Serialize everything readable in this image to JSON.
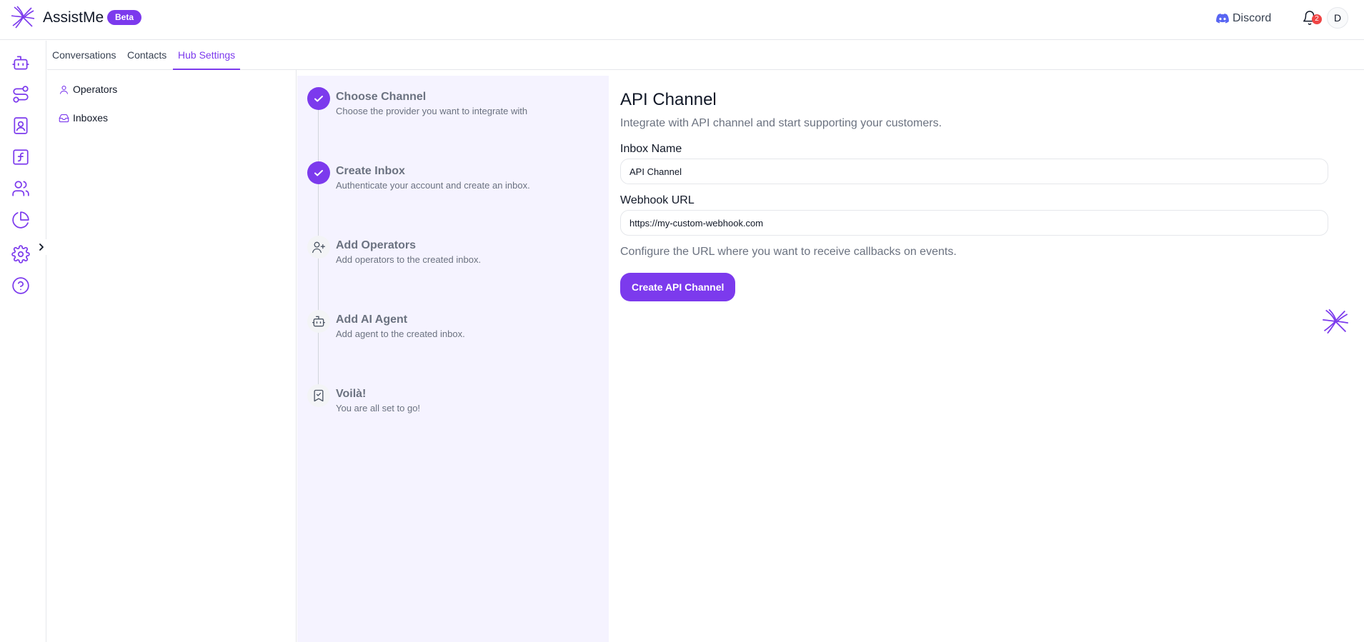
{
  "header": {
    "app_name": "AssistMe",
    "badge": "Beta",
    "discord_label": "Discord",
    "notification_count": "2",
    "avatar_initial": "D",
    "accent_color": "#7c3aed"
  },
  "rail": {
    "icons": [
      "bot-icon",
      "workflow-icon",
      "contact-book-icon",
      "function-icon",
      "users-icon",
      "pie-chart-icon",
      "gear-icon",
      "help-icon"
    ],
    "toggle_icon": "chevron-right-icon"
  },
  "tabs": [
    {
      "label": "Conversations",
      "active": false
    },
    {
      "label": "Contacts",
      "active": false
    },
    {
      "label": "Hub Settings",
      "active": true
    }
  ],
  "settings_sidebar": {
    "items": [
      {
        "label": "Operators",
        "icon": "user-icon"
      },
      {
        "label": "Inboxes",
        "icon": "inbox-icon"
      }
    ]
  },
  "stepper": {
    "steps": [
      {
        "title": "Choose Channel",
        "description": "Choose the provider you want to integrate with",
        "status": "done",
        "icon": "check-icon"
      },
      {
        "title": "Create Inbox",
        "description": "Authenticate your account and create an inbox.",
        "status": "done",
        "icon": "check-icon"
      },
      {
        "title": "Add Operators",
        "description": "Add operators to the created inbox.",
        "status": "todo",
        "icon": "user-plus-icon"
      },
      {
        "title": "Add AI Agent",
        "description": "Add agent to the created inbox.",
        "status": "todo",
        "icon": "bot-icon"
      },
      {
        "title": "Voilà!",
        "description": "You are all set to go!",
        "status": "todo",
        "icon": "bookmark-check-icon"
      }
    ]
  },
  "form": {
    "title": "API Channel",
    "subtitle": "Integrate with API channel and start supporting your customers.",
    "inbox_name_label": "Inbox Name",
    "inbox_name_value": "API Channel",
    "webhook_label": "Webhook URL",
    "webhook_value": "https://my-custom-webhook.com",
    "webhook_hint": "Configure the URL where you want to receive callbacks on events.",
    "submit_label": "Create API Channel"
  }
}
